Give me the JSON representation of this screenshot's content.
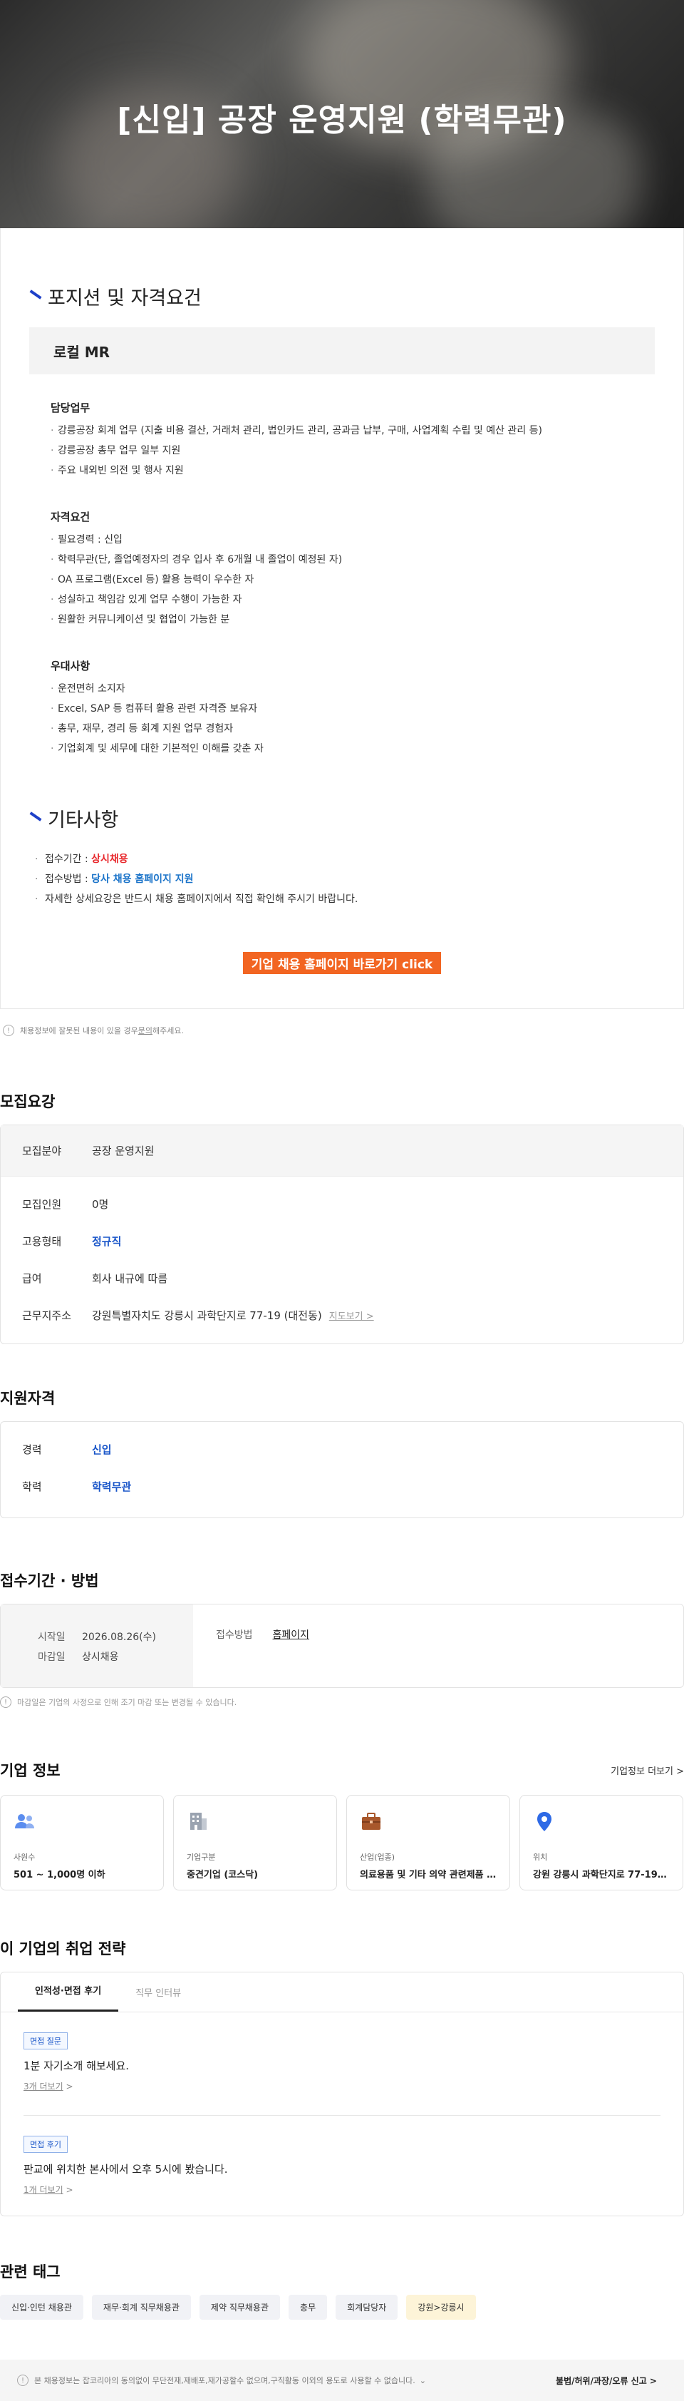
{
  "hero": {
    "title": "[신입] 공장 운영지원 (학력무관)"
  },
  "position": {
    "heading": "포지션 및 자격요건",
    "company_label": "로컬 MR",
    "groups": [
      {
        "title": "담당업무",
        "items": [
          "강릉공장 회계 업무 (지출 비용 결산, 거래처 관리, 법인카드 관리, 공과금 납부, 구매, 사업계획 수립 및 예산 관리 등)",
          "강릉공장 총무 업무 일부 지원",
          "주요 내외빈 의전 및 행사 지원"
        ]
      },
      {
        "title": "자격요건",
        "items": [
          "필요경력 : 신입",
          "학력무관(단, 졸업예정자의 경우 입사 후 6개월 내 졸업이 예정된 자)",
          "OA 프로그램(Excel 등) 활용 능력이 우수한 자",
          "성실하고 책임감 있게 업무 수행이 가능한 자",
          "원활한 커뮤니케이션 및 협업이 가능한 분"
        ]
      },
      {
        "title": "우대사항",
        "items": [
          "운전면허 소지자",
          "Excel, SAP 등 컴퓨터 활용 관련 자격증 보유자",
          "총무, 재무, 경리 등 회계 지원 업무 경험자",
          "기업회계 및 세무에 대한 기본적인 이해를 갖춘 자"
        ]
      }
    ]
  },
  "etc": {
    "heading": "기타사항",
    "period_prefix": "접수기간 : ",
    "period_value": "상시채용",
    "method_prefix": "접수방법 : ",
    "method_value": "당사 채용 홈페이지 지원",
    "note": "자세한 상세요강은 반드시 채용 홈페이지에서 직접 확인해 주시기 바랍니다.",
    "cta": "기업 채용 홈페이지 바로가기 click"
  },
  "report": {
    "icon": "!",
    "text_before": "채용정보에 잘못된 내용이 있을 경우 ",
    "link": "문의",
    "text_after": "해주세요."
  },
  "recruit": {
    "title": "모집요강",
    "field_label": "모집분야",
    "field_value": "공장 운영지원",
    "rows": [
      {
        "k": "모집인원",
        "v": "0명"
      },
      {
        "k": "고용형태",
        "v": "정규직"
      },
      {
        "k": "급여",
        "v": "회사 내규에 따름"
      },
      {
        "k": "근무지주소",
        "v": "강원특별자치도 강릉시 과학단지로 77-19 (대전동)"
      }
    ],
    "map_link": "지도보기 >"
  },
  "qualify": {
    "title": "지원자격",
    "career_label": "경력",
    "career_value": "신입",
    "edu_label": "학력",
    "edu_value": "학력무관"
  },
  "period": {
    "title": "접수기간 · 방법",
    "start_label": "시작일",
    "start_value": "2026.08.26(수)",
    "end_label": "마감일",
    "end_value": "상시채용",
    "method_label": "접수방법",
    "method_value": "홈페이지",
    "note": "마감일은 기업의 사정으로 인해 조기 마감 또는 변경될 수 있습니다."
  },
  "company": {
    "title": "기업 정보",
    "more": "기업정보 더보기 >",
    "tiles": [
      {
        "icon": "people-icon",
        "label": "사원수",
        "value": "501 ~ 1,000명 이하",
        "color": "#5b8def"
      },
      {
        "icon": "building-icon",
        "label": "기업구분",
        "value": "중견기업 (코스닥)",
        "color": "#9aa3b0"
      },
      {
        "icon": "briefcase-icon",
        "label": "산업(업종)",
        "value": "의료용품 및 기타 의약 관련제품 ...",
        "color": "#a8572b"
      },
      {
        "icon": "location-pin-icon",
        "label": "위치",
        "value": "강원 강릉시 과학단지로 77-19 ...",
        "color": "#2e6ae6"
      }
    ]
  },
  "strategy": {
    "title": "이 기업의 취업 전략",
    "tabs": [
      "인적성·면접 후기",
      "직무 인터뷰"
    ],
    "items": [
      {
        "badge": "면접 질문",
        "text": "1분 자기소개 해보세요.",
        "more": "3개 더보기"
      },
      {
        "badge": "면접 후기",
        "text": "판교에 위치한 본사에서 오후 5시에 봤습니다.",
        "more": "1개 더보기"
      }
    ]
  },
  "tags": {
    "title": "관련 태그",
    "items": [
      "신입·인턴 채용관",
      "재무·회계 직무채용관",
      "제약 직무채용관",
      "총무",
      "회계담당자",
      "강원>강릉시"
    ]
  },
  "footer": {
    "notice": "본 채용정보는 잡코리아의 동의없이 무단전재,재배포,재가공할수 없으며,구직활동 이외의 용도로 사용할 수 없습니다.",
    "report": "불법/허위/과장/오류 신고 >"
  }
}
